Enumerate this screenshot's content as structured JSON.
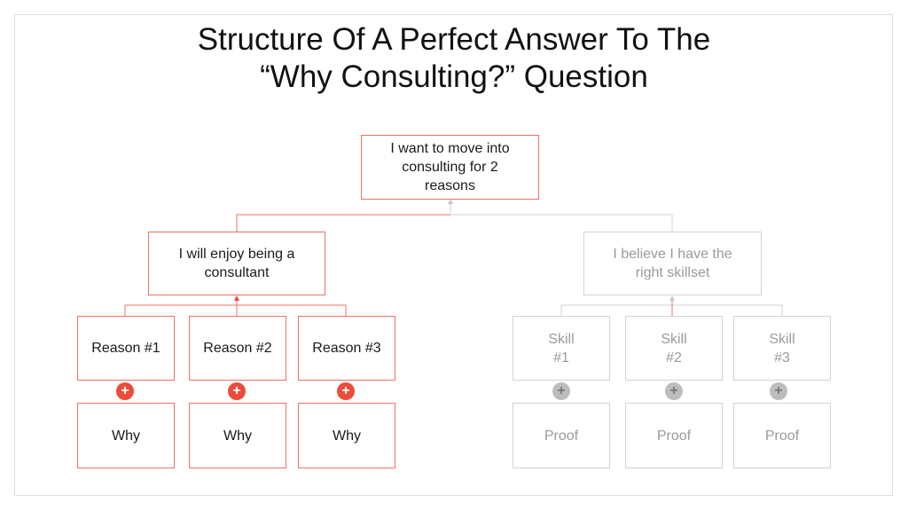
{
  "title": {
    "line1": "Structure Of A Perfect Answer To The",
    "line2": "“Why Consulting?” Question"
  },
  "colors": {
    "accent": "#ee7066",
    "accent_plus": "#ec4c3a",
    "muted": "#d2d2d2",
    "muted_text": "#9a9a9a"
  },
  "root": {
    "text": "I want to move into consulting for 2 reasons"
  },
  "branches": [
    {
      "text": "I will enjoy being a consultant",
      "state": "active",
      "children": [
        {
          "label": "Reason #1",
          "detail": "Why"
        },
        {
          "label": "Reason #2",
          "detail": "Why"
        },
        {
          "label": "Reason #3",
          "detail": "Why"
        }
      ]
    },
    {
      "text": "I believe I have the right skillset",
      "state": "inactive",
      "children": [
        {
          "label": "Skill #1",
          "detail": "Proof"
        },
        {
          "label": "Skill #2",
          "detail": "Proof"
        },
        {
          "label": "Skill #3",
          "detail": "Proof"
        }
      ]
    }
  ],
  "plus_symbol": "+"
}
